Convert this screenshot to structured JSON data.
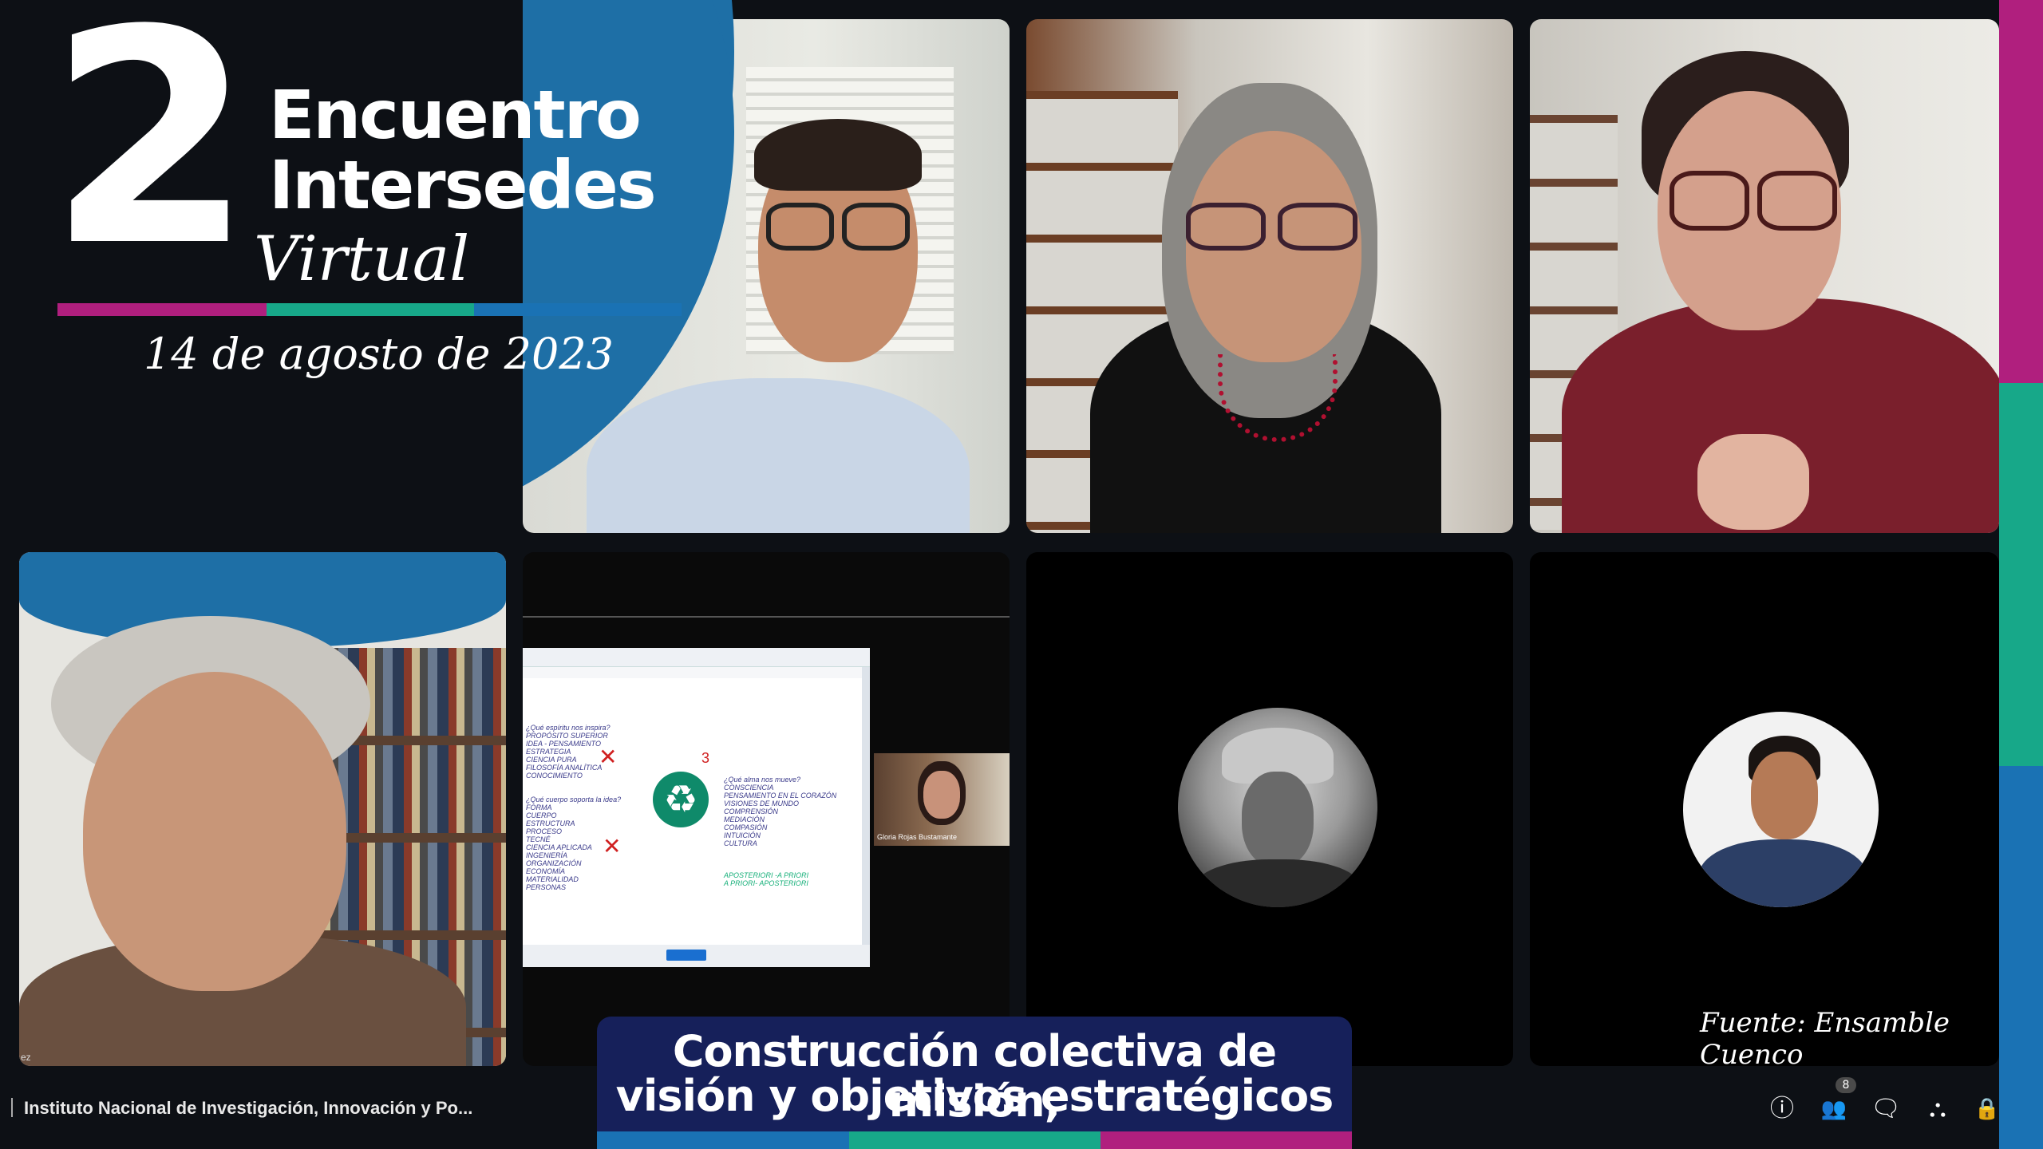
{
  "branding": {
    "number": "2",
    "title_line1": "Encuentro",
    "title_line2": "Intersedes",
    "subtitle": "Virtual",
    "date": "14 de agosto de 2023"
  },
  "colors": {
    "magenta": "#b01f7e",
    "teal": "#17a889",
    "blue": "#1a72b4",
    "navy": "#16205a"
  },
  "caption": {
    "line1": "Construcción colectiva de misión,",
    "line2": "visión y objetivos estratégicos"
  },
  "source_credit": "Fuente: Ensamble Cuenco",
  "meeting": {
    "name": "Instituto Nacional de Investigación, Innovación y Po..."
  },
  "participants_count": "8",
  "tiles": {
    "bottom_left_name_fragment": "ez",
    "shared_screen": {
      "presenter_name": "Gloria Rojas Bustamante",
      "number_label": "3",
      "left_block": "¿Qué espíritu nos inspira?\nPROPÓSITO SUPERIOR\nIDEA - PENSAMIENTO\nESTRATEGIA\nCIENCIA PURA\nFILOSOFÍA ANALÍTICA\nCONOCIMIENTO\n\n\n¿Qué cuerpo soporta la idea?\nFORMA\nCUERPO\nESTRUCTURA\nPROCESO\nTECNÉ\nCIENCIA APLICADA\nINGENIERÍA\nORGANIZACIÓN\nECONOMÍA\nMATERIALIDAD\nPERSONAS",
      "right_block": "¿Qué alma nos mueve?\nCONSCIENCIA\nPENSAMIENTO EN EL CORAZÓN\nVISIONES DE MUNDO\nCOMPRENSIÓN\nMEDIACIÓN\nCOMPASIÓN\nINTUICIÓN\nCULTURA",
      "green_block": "APOSTERIORI -A PRIORI\nA PRIORI- APOSTERIORI"
    }
  },
  "controls": [
    {
      "name": "info-icon",
      "glyph": "ⓘ"
    },
    {
      "name": "people-icon",
      "glyph": "👥"
    },
    {
      "name": "chat-icon",
      "glyph": "🗨"
    },
    {
      "name": "activities-icon",
      "glyph": "⛬"
    },
    {
      "name": "lock-icon",
      "glyph": "🔒"
    }
  ]
}
